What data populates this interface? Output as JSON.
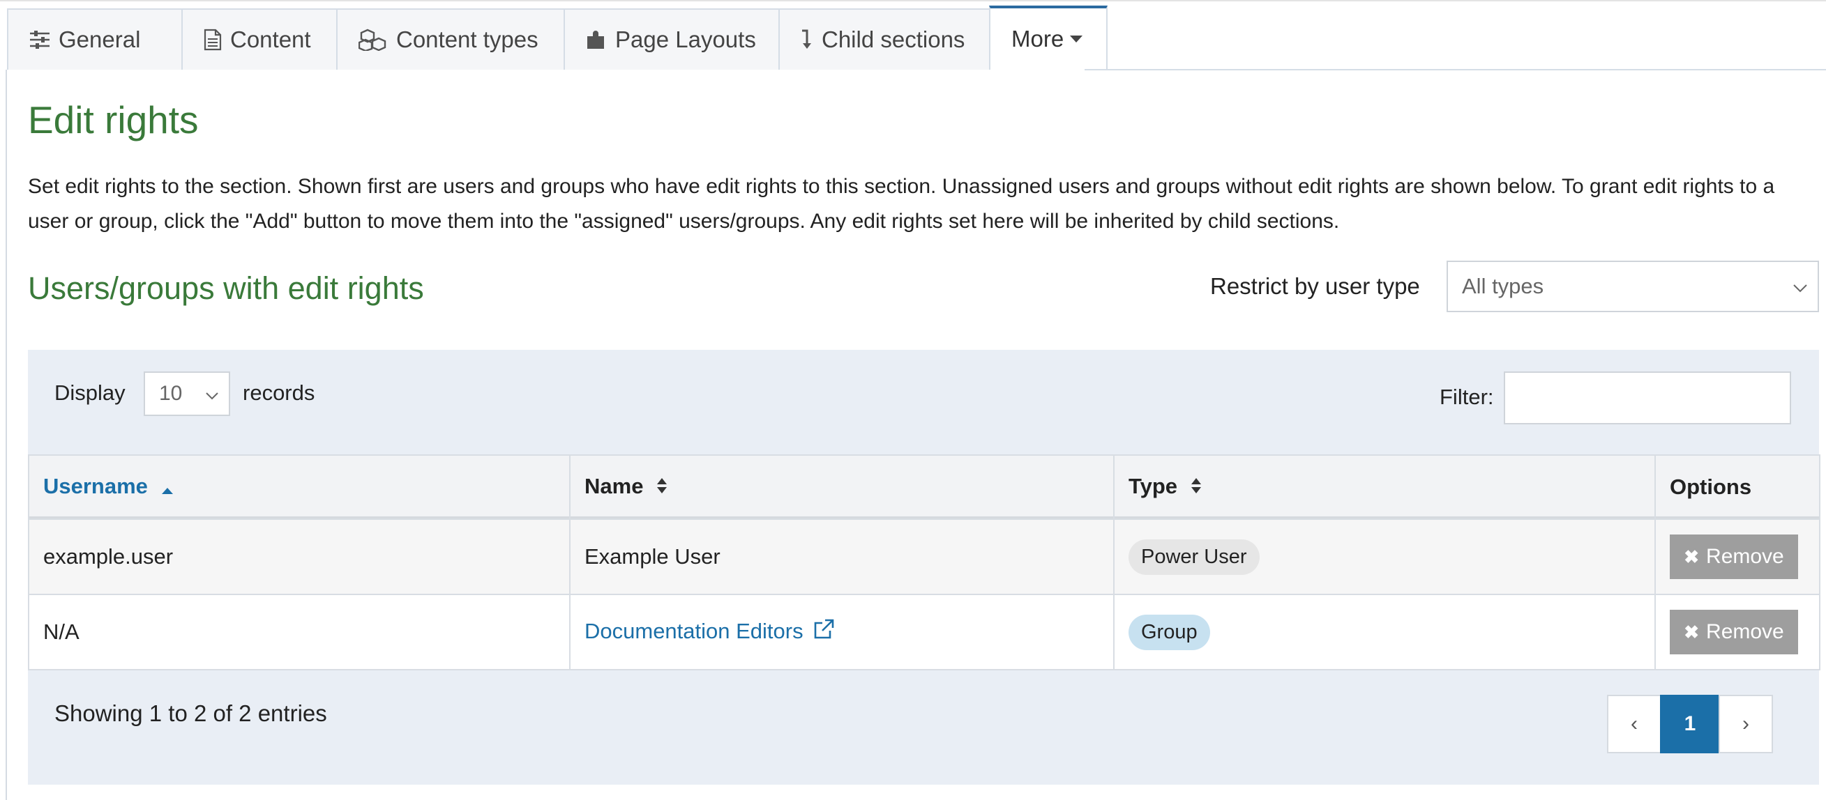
{
  "tabs": [
    {
      "label": "General",
      "icon": "sliders-icon"
    },
    {
      "label": "Content",
      "icon": "document-icon"
    },
    {
      "label": "Content types",
      "icon": "cubes-icon"
    },
    {
      "label": "Page Layouts",
      "icon": "puzzle-icon"
    },
    {
      "label": "Child sections",
      "icon": "arrow-down-icon"
    },
    {
      "label": "More",
      "icon": "caret-down-icon",
      "active": true
    }
  ],
  "page": {
    "title": "Edit rights",
    "description": "Set edit rights to the section. Shown first are users and groups who have edit rights to this section. Unassigned users and groups without edit rights are shown below. To grant edit rights to a user or group, click the \"Add\" button to move them into the \"assigned\" users/groups. Any edit rights set here will be inherited by child sections.",
    "section_title": "Users/groups with edit rights",
    "restrict_label": "Restrict by user type",
    "restrict_value": "All types"
  },
  "table_controls": {
    "display_label": "Display",
    "page_length": "10",
    "records_label": "records",
    "filter_label": "Filter:",
    "filter_value": ""
  },
  "table": {
    "columns": [
      "Username",
      "Name",
      "Type",
      "Options"
    ],
    "rows": [
      {
        "username": "example.user",
        "name": "Example User",
        "type": "Power User",
        "option": "Remove"
      },
      {
        "username": "N/A",
        "name": "Documentation Editors",
        "type": "Group",
        "option": "Remove"
      }
    ]
  },
  "footer": {
    "info": "Showing 1 to 2 of 2 entries",
    "prev": "‹",
    "page": "1",
    "next": "›"
  },
  "colors": {
    "heading_green": "#3a7a3a",
    "link_blue": "#1b6fa8",
    "panel_bg": "#e9eef5",
    "remove_gray": "#9e9e9e"
  }
}
